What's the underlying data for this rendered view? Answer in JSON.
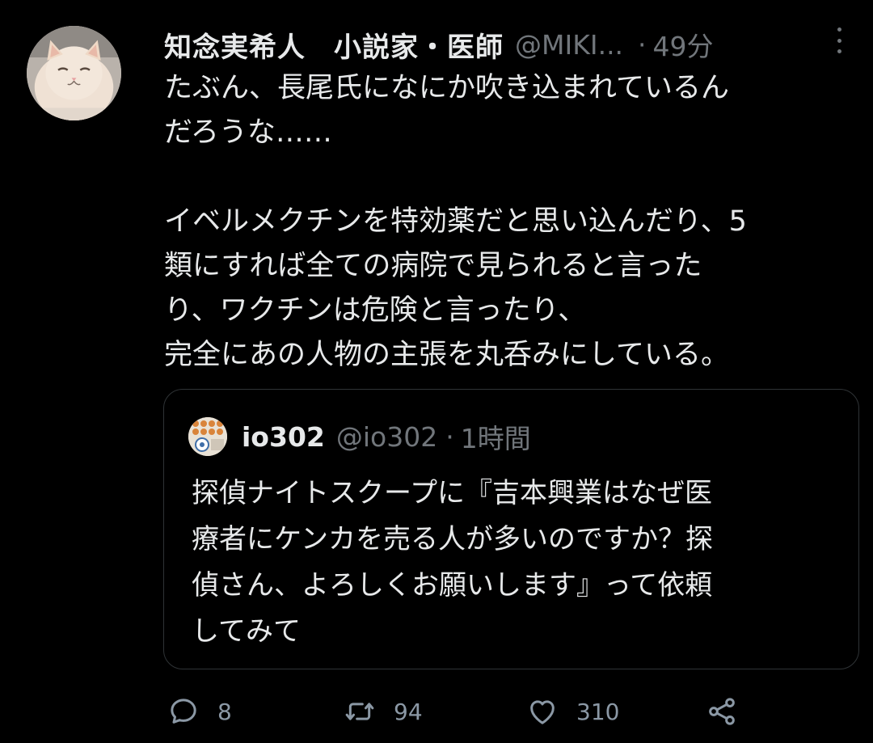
{
  "tweet": {
    "display_name": "知念実希人　小説家・医師",
    "handle": "@MIKI...",
    "separator": "·",
    "time": "49分",
    "lines": [
      "たぶん、長尾氏になにか吹き込まれているん",
      "だろうな……",
      "",
      "イベルメクチンを特効薬だと思い込んだり、5",
      "類にすれば全ての病院で見られると言った",
      "り、ワクチンは危険と言ったり、",
      "完全にあの人物の主張を丸呑みにしている。"
    ]
  },
  "quote": {
    "display_name": "io302",
    "handle": "@io302",
    "separator": "·",
    "time": "1時間",
    "lines": [
      "探偵ナイトスクープに『吉本興業はなぜ医",
      "療者にケンカを売る人が多いのですか？探",
      "偵さん、よろしくお願いします』って依頼",
      "してみて"
    ]
  },
  "actions": {
    "reply": {
      "icon": "reply-icon",
      "count": "8"
    },
    "retweet": {
      "icon": "retweet-icon",
      "count": "94"
    },
    "like": {
      "icon": "heart-icon",
      "count": "310"
    },
    "share": {
      "icon": "share-icon",
      "count": ""
    }
  },
  "colors": {
    "background": "#000000",
    "text": "#e7e9ea",
    "secondary": "#71767b",
    "border": "#2f3336"
  }
}
